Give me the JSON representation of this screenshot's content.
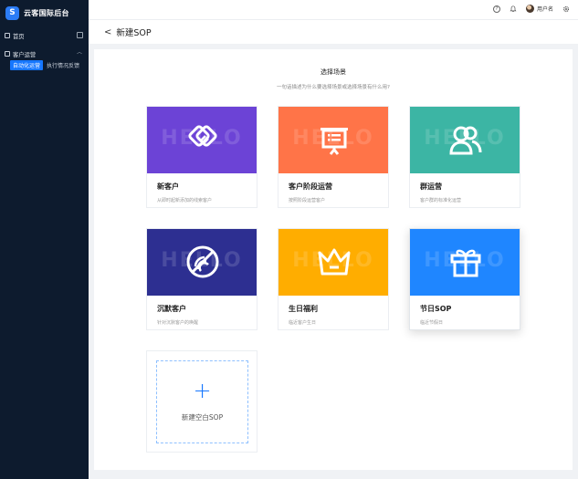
{
  "app": {
    "name": "云客国际后台",
    "logo_letter": "S"
  },
  "sidebar": {
    "items": [
      {
        "label": "首页"
      },
      {
        "label": "客户运营"
      }
    ],
    "sub_items": [
      {
        "label": "自动化运营",
        "active": true
      },
      {
        "label": "执行情况反馈",
        "active": false
      }
    ]
  },
  "header": {
    "user_name": "用户名"
  },
  "page": {
    "back": "<",
    "title": "新建SOP"
  },
  "section": {
    "title": "选择场景",
    "subtitle": "一句话描述为什么要选择场景或选择场景有什么用?"
  },
  "watermark": "HELLO",
  "scenes": [
    {
      "name": "新客户",
      "desc": "从即时起新添加的线索客户",
      "color": "#6c43d6"
    },
    {
      "name": "客户阶段运营",
      "desc": "按照阶段运营客户",
      "color": "#ff7448"
    },
    {
      "name": "群运营",
      "desc": "客户群的标准化运营",
      "color": "#3cb5a4"
    },
    {
      "name": "沉默客户",
      "desc": "针对沉默客户的唤醒",
      "color": "#2d2f91"
    },
    {
      "name": "生日福利",
      "desc": "临近客户生日",
      "color": "#ffad00"
    },
    {
      "name": "节日SOP",
      "desc": "临近节假日",
      "color": "#1f86ff"
    }
  ],
  "blank": {
    "plus": "+",
    "label": "新建空白SOP"
  }
}
